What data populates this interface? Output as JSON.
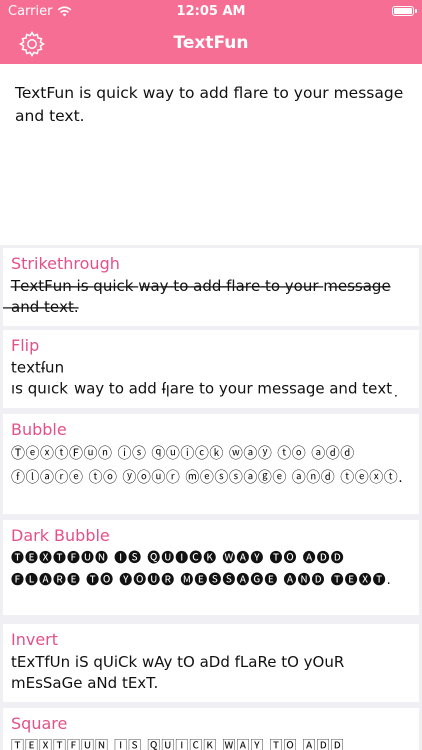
{
  "status_bar": {
    "carrier": "Carrier",
    "time": "12:05 AM",
    "icons": [
      "wifi-icon",
      "battery-icon"
    ]
  },
  "nav": {
    "title": "TextFun",
    "settings_icon": "gear-icon"
  },
  "input": {
    "text": "TextFun is quick way to add flare to your message and text."
  },
  "colors": {
    "accent": "#f76e95",
    "label": "#e4508a",
    "background": "#efeff4"
  },
  "styles": [
    {
      "label": "Strikethrough",
      "result": "T̶e̶x̶t̶F̶u̶n̶ ̶i̶s̶ ̶q̶u̶i̶c̶k̶ ̶w̶a̶y̶ ̶t̶o̶ ̶a̶d̶d̶ ̶f̶l̶a̶r̶e̶ ̶t̶o̶ ̶y̶o̶u̶r̶ ̶m̶e̶s̶s̶a̶g̶e̶ ̶a̶n̶d̶ ̶t̶e̶x̶t̶.̶"
    },
    {
      "label": "Flip",
      "result": "˙ʇxǝʇ puɐ ǝɓɐssǝɯ ɹnoʎ oʇ ǝɹɐlɟ ppɐ oʇ ʎɐʍ ʞɔınb sı unɟʇxǝʇ"
    },
    {
      "label": "Bubble",
      "result": "ⓉⓔⓧⓣⒻⓤⓝ ⓘⓢ ⓠⓤⓘⓒⓚ ⓦⓐⓨ ⓣⓞ ⓐⓓⓓ ⓕⓛⓐⓡⓔ ⓣⓞ ⓨⓞⓤⓡ ⓜⓔⓢⓢⓐⓖⓔ ⓐⓝⓓ ⓣⓔⓧⓣ."
    },
    {
      "label": "Dark Bubble",
      "result": "🅣🅔🅧🅣🅕🅤🅝 🅘🅢 🅠🅤🅘🅒🅚 🅦🅐🅨 🅣🅞 🅐🅓🅓 🅕🅛🅐🅡🅔 🅣🅞 🅨🅞🅤🅡 🅜🅔🅢🅢🅐🅖🅔 🅐🅝🅓 🅣🅔🅧🅣."
    },
    {
      "label": "Invert",
      "result": "tExTfUn iS qUiCk wAy tO aDd fLaRe tO yOuR mEsSaGe aNd tExT."
    },
    {
      "label": "Square",
      "result": "🅃🄴🅇🅃🄵🅄🄽 🄸🅂 🅀🅄🄸🄲🄺 🅆🄰🅈 🅃🄾 🄰🄳🄳"
    }
  ]
}
